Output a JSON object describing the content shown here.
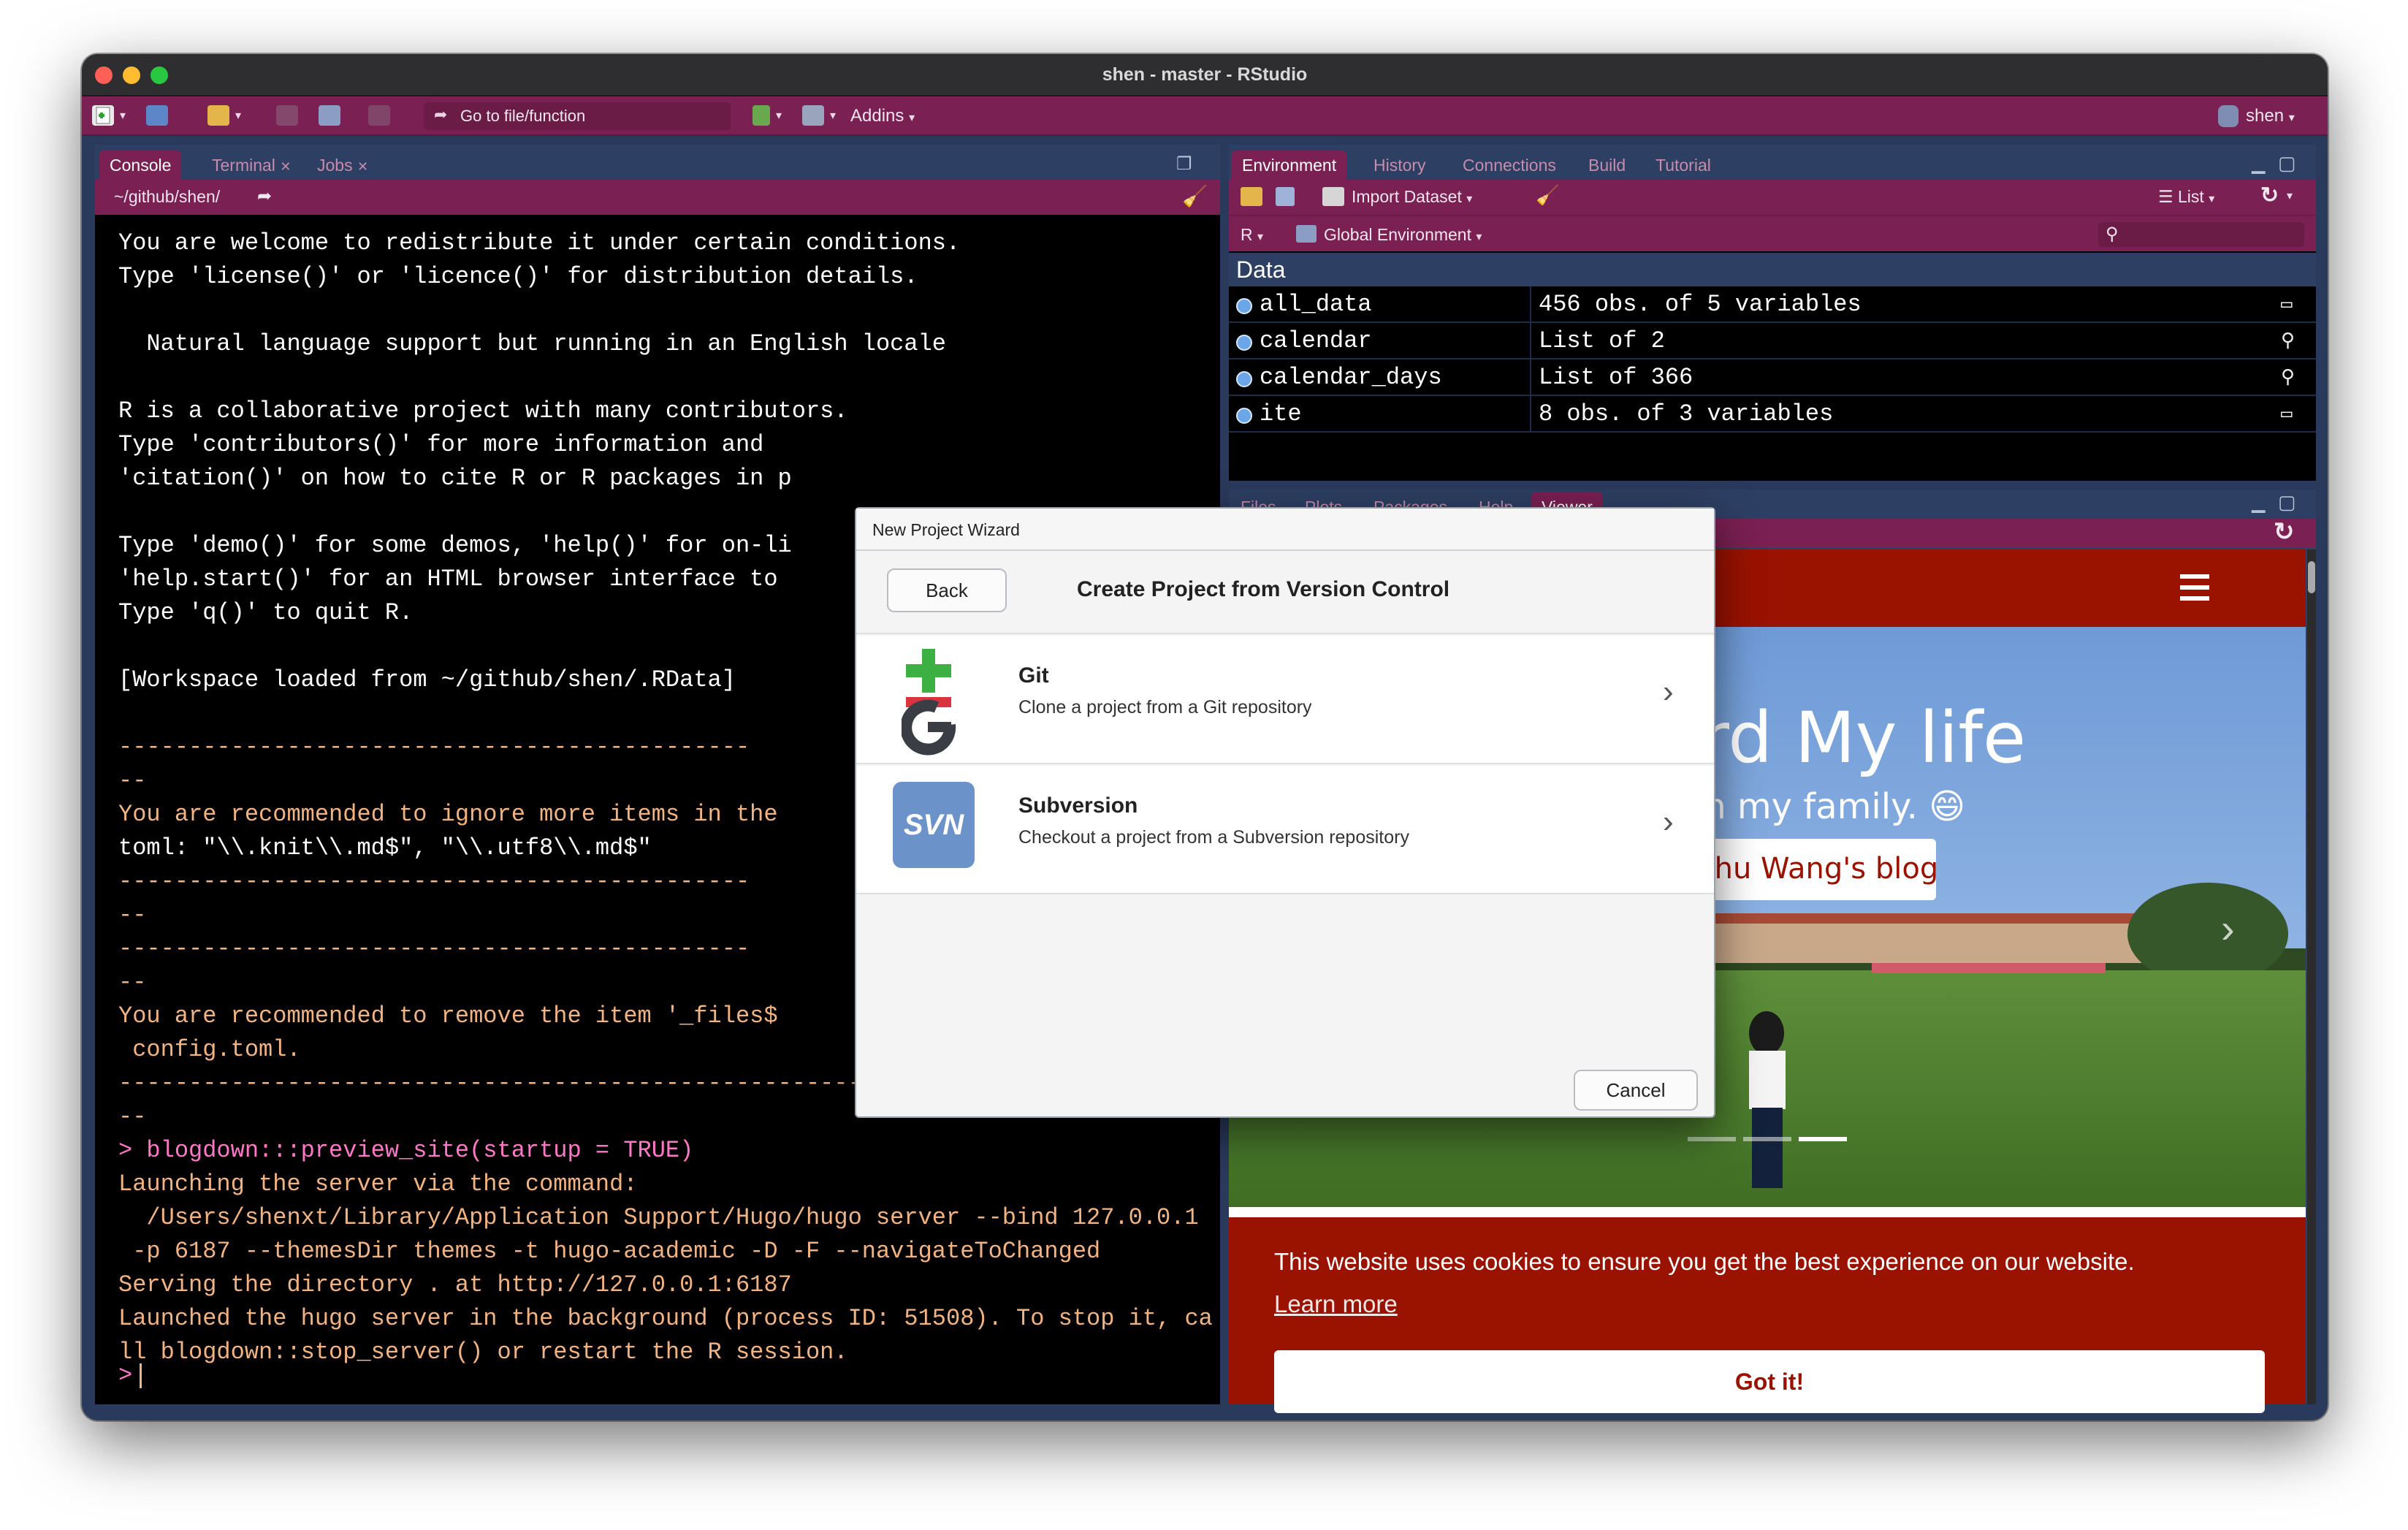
{
  "window": {
    "title": "shen - master - RStudio"
  },
  "toolbar": {
    "goto_placeholder": "Go to file/function",
    "addins_label": "Addins",
    "user_label": "shen"
  },
  "console_pane": {
    "tabs": [
      "Console",
      "Terminal",
      "Jobs"
    ],
    "path": "~/github/shen/",
    "lines": [
      {
        "text": "You are welcome to redistribute it under certain conditions.",
        "color": "#ffffff"
      },
      {
        "text": "Type 'license()' or 'licence()' for distribution details.",
        "color": "#ffffff"
      },
      {
        "text": "",
        "color": "#ffffff"
      },
      {
        "text": "  Natural language support but running in an English locale",
        "color": "#ffffff"
      },
      {
        "text": "",
        "color": "#ffffff"
      },
      {
        "text": "R is a collaborative project with many contributors.",
        "color": "#ffffff"
      },
      {
        "text": "Type 'contributors()' for more information and",
        "color": "#ffffff"
      },
      {
        "text": "'citation()' on how to cite R or R packages in p",
        "color": "#ffffff"
      },
      {
        "text": "",
        "color": "#ffffff"
      },
      {
        "text": "Type 'demo()' for some demos, 'help()' for on-li",
        "color": "#ffffff"
      },
      {
        "text": "'help.start()' for an HTML browser interface to",
        "color": "#ffffff"
      },
      {
        "text": "Type 'q()' to quit R.",
        "color": "#ffffff"
      },
      {
        "text": "",
        "color": "#ffffff"
      },
      {
        "text": "[Workspace loaded from ~/github/shen/.RData]",
        "color": "#ffffff"
      },
      {
        "text": "",
        "color": "#ffffff"
      },
      {
        "text": "---------------------------------------------",
        "color": "#f2b382"
      },
      {
        "text": "--",
        "color": "#f2b382"
      },
      {
        "text": "You are recommended to ignore more items in the",
        "color": "#f2b382"
      },
      {
        "text": "toml: \"\\\\.knit\\\\.md$\", \"\\\\.utf8\\\\.md$\"",
        "color": "#ffffff"
      },
      {
        "text": "---------------------------------------------",
        "color": "#f2b382"
      },
      {
        "text": "--",
        "color": "#f2b382"
      },
      {
        "text": "---------------------------------------------",
        "color": "#f2b382"
      },
      {
        "text": "--",
        "color": "#f2b382"
      },
      {
        "text": "You are recommended to remove the item '_files$",
        "color": "#f2b382"
      },
      {
        "text": " config.toml.",
        "color": "#f2b382"
      },
      {
        "text": "---------------------------------------------------------------------------",
        "color": "#f2b382"
      },
      {
        "text": "--",
        "color": "#f2b382"
      },
      {
        "text": "> blogdown:::preview_site(startup = TRUE)",
        "color": "#ff78c8"
      },
      {
        "text": "Launching the server via the command:",
        "color": "#f2b382"
      },
      {
        "text": "  /Users/shenxt/Library/Application Support/Hugo/hugo server --bind 127.0.0.1",
        "color": "#f2b382"
      },
      {
        "text": " -p 6187 --themesDir themes -t hugo-academic -D -F --navigateToChanged",
        "color": "#f2b382"
      },
      {
        "text": "Serving the directory . at http://127.0.0.1:6187",
        "color": "#f2b382"
      },
      {
        "text": "Launched the hugo server in the background (process ID: 51508). To stop it, ca",
        "color": "#f2b382"
      },
      {
        "text": "ll blogdown::stop_server() or restart the R session.",
        "color": "#f2b382"
      }
    ],
    "prompt": ">"
  },
  "env_pane": {
    "tabs": [
      "Environment",
      "History",
      "Connections",
      "Build",
      "Tutorial"
    ],
    "import_label": "Import Dataset",
    "list_label": "List",
    "lang_label": "R",
    "scope_label": "Global Environment",
    "section_label": "Data",
    "rows": [
      {
        "name": "all_data",
        "value": "456 obs. of 5 variables"
      },
      {
        "name": "calendar",
        "value": "List of  2"
      },
      {
        "name": "calendar_days",
        "value": "List of  366"
      },
      {
        "name": "ite",
        "value": "8 obs. of 3 variables"
      }
    ]
  },
  "viewer_pane": {
    "tabs": [
      "Files",
      "Plots",
      "Packages",
      "Help",
      "Viewer"
    ],
    "hero_title": "cord My life",
    "hero_subtitle": "e with my family.",
    "hero_emoji": "😄",
    "blog_button": "Chuchu Wang's blog",
    "cookie_text": "This website uses cookies to ensure you get the best experience on our website.",
    "cookie_link": "Learn more",
    "cookie_button": "Got it!"
  },
  "modal": {
    "title": "New Project Wizard",
    "back_label": "Back",
    "heading": "Create Project from Version Control",
    "options": [
      {
        "name": "Git",
        "desc": "Clone a project from a Git repository"
      },
      {
        "name": "Subversion",
        "desc": "Checkout a project from a Subversion repository"
      }
    ],
    "svn_icon_text": "SVN",
    "cancel_label": "Cancel"
  },
  "colors": {
    "accent": "#7a2052",
    "pane_bg": "#2d3f63",
    "console_text": "#ffffff",
    "warning_text": "#f2b382",
    "command_text": "#ff78c8",
    "site_red": "#9a1200"
  }
}
